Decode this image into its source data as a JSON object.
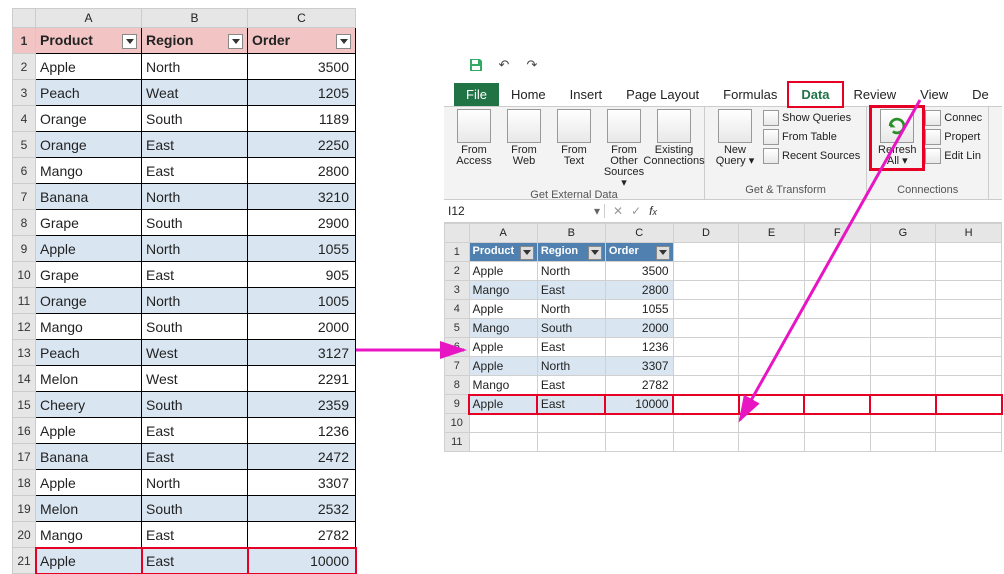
{
  "left": {
    "cols": [
      "A",
      "B",
      "C"
    ],
    "headers": [
      "Product",
      "Region",
      "Order"
    ],
    "rows": [
      {
        "n": 1
      },
      {
        "n": 2,
        "c": [
          "Apple",
          "North",
          "3500"
        ]
      },
      {
        "n": 3,
        "c": [
          "Peach",
          "Weat",
          "1205"
        ]
      },
      {
        "n": 4,
        "c": [
          "Orange",
          "South",
          "1189"
        ]
      },
      {
        "n": 5,
        "c": [
          "Orange",
          "East",
          "2250"
        ]
      },
      {
        "n": 6,
        "c": [
          "Mango",
          "East",
          "2800"
        ]
      },
      {
        "n": 7,
        "c": [
          "Banana",
          "North",
          "3210"
        ]
      },
      {
        "n": 8,
        "c": [
          "Grape",
          "South",
          "2900"
        ]
      },
      {
        "n": 9,
        "c": [
          "Apple",
          "North",
          "1055"
        ]
      },
      {
        "n": 10,
        "c": [
          "Grape",
          "East",
          "905"
        ]
      },
      {
        "n": 11,
        "c": [
          "Orange",
          "North",
          "1005"
        ]
      },
      {
        "n": 12,
        "c": [
          "Mango",
          "South",
          "2000"
        ]
      },
      {
        "n": 13,
        "c": [
          "Peach",
          "West",
          "3127"
        ]
      },
      {
        "n": 14,
        "c": [
          "Melon",
          "West",
          "2291"
        ]
      },
      {
        "n": 15,
        "c": [
          "Cheery",
          "South",
          "2359"
        ]
      },
      {
        "n": 16,
        "c": [
          "Apple",
          "East",
          "1236"
        ]
      },
      {
        "n": 17,
        "c": [
          "Banana",
          "East",
          "2472"
        ]
      },
      {
        "n": 18,
        "c": [
          "Apple",
          "North",
          "3307"
        ]
      },
      {
        "n": 19,
        "c": [
          "Melon",
          "South",
          "2532"
        ]
      },
      {
        "n": 20,
        "c": [
          "Mango",
          "East",
          "2782"
        ]
      },
      {
        "n": 21,
        "c": [
          "Apple",
          "East",
          "10000"
        ],
        "hl": true
      }
    ]
  },
  "ribbon": {
    "tabs": [
      "File",
      "Home",
      "Insert",
      "Page Layout",
      "Formulas",
      "Data",
      "Review",
      "View",
      "De"
    ],
    "active_tab": 5,
    "groups": {
      "get_external": {
        "caption": "Get External Data",
        "btns": [
          {
            "label": "From Access"
          },
          {
            "label": "From Web"
          },
          {
            "label": "From Text"
          },
          {
            "label": "From Other Sources ▾"
          },
          {
            "label": "Existing Connections"
          }
        ]
      },
      "get_transform": {
        "caption": "Get & Transform",
        "big": {
          "label": "New Query ▾"
        },
        "small": [
          {
            "label": "Show Queries"
          },
          {
            "label": "From Table"
          },
          {
            "label": "Recent Sources"
          }
        ]
      },
      "connections": {
        "caption": "Connections",
        "big": {
          "label": "Refresh All ▾"
        },
        "small": [
          {
            "label": "Connec"
          },
          {
            "label": "Propert"
          },
          {
            "label": "Edit Lin"
          }
        ]
      }
    }
  },
  "namebox": "I12",
  "right": {
    "cols": [
      "A",
      "B",
      "C",
      "D",
      "E",
      "F",
      "G",
      "H"
    ],
    "headers": [
      "Product",
      "Region",
      "Order"
    ],
    "rows": [
      {
        "n": 1
      },
      {
        "n": 2,
        "c": [
          "Apple",
          "North",
          "3500"
        ]
      },
      {
        "n": 3,
        "c": [
          "Mango",
          "East",
          "2800"
        ]
      },
      {
        "n": 4,
        "c": [
          "Apple",
          "North",
          "1055"
        ]
      },
      {
        "n": 5,
        "c": [
          "Mango",
          "South",
          "2000"
        ]
      },
      {
        "n": 6,
        "c": [
          "Apple",
          "East",
          "1236"
        ]
      },
      {
        "n": 7,
        "c": [
          "Apple",
          "North",
          "3307"
        ]
      },
      {
        "n": 8,
        "c": [
          "Mango",
          "East",
          "2782"
        ]
      },
      {
        "n": 9,
        "c": [
          "Apple",
          "East",
          "10000"
        ],
        "hl": true
      },
      {
        "n": 10
      },
      {
        "n": 11
      }
    ]
  }
}
